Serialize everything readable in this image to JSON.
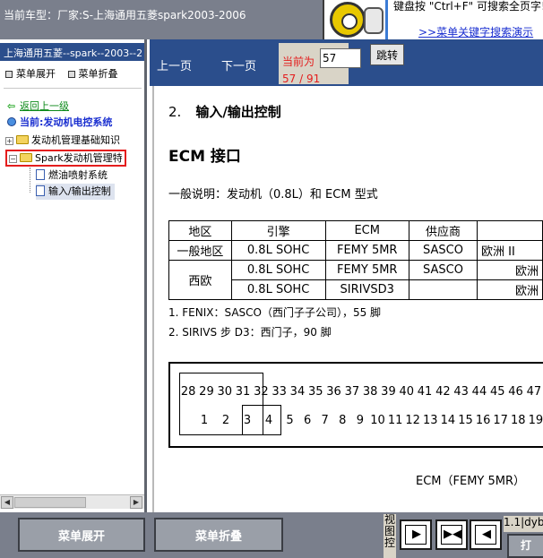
{
  "topbar": {
    "car_title": "当前车型：厂家:S-上海通用五菱spark2003-2006",
    "tip_text": "键盘按 \"Ctrl+F\" 可搜索全页字!",
    "tip_link": ">>菜单关键字搜索演示"
  },
  "left_panel": {
    "header": "上海通用五菱--spark--2003--2",
    "toolbar": {
      "expand": "菜单展开",
      "collapse": "菜单折叠"
    },
    "tree": {
      "back": "返回上一级",
      "current": "当前:发动机电控系统",
      "items": [
        {
          "label": "发动机管理基础知识",
          "type": "folder"
        },
        {
          "label": "Spark发动机管理特",
          "type": "folder",
          "highlighted": true
        },
        {
          "label": "燃油喷射系统",
          "type": "doc"
        },
        {
          "label": "输入/输出控制",
          "type": "doc",
          "selected": true
        }
      ]
    }
  },
  "nav": {
    "prev": "上一页",
    "next": "下一页",
    "current_label": "当前为",
    "page_value": "57",
    "page_count": "57 / 91",
    "jump": "跳转"
  },
  "document": {
    "section_number": "2.",
    "section_title": "输入/输出控制",
    "ecm_heading": "ECM 接口",
    "general_desc": "一般说明：发动机（0.8L）和 ECM 型式",
    "table": {
      "headers": [
        "地区",
        "引擎",
        "ECM",
        "供应商",
        ""
      ],
      "rows": [
        {
          "region": "一般地区",
          "engine": "0.8L SOHC",
          "ecm": "FEMY 5MR",
          "supplier": "SASCO",
          "market": "欧洲 II"
        },
        {
          "region": "西欧",
          "engine": "0.8L SOHC",
          "ecm": "FEMY 5MR",
          "supplier": "SASCO",
          "market": "欧洲"
        },
        {
          "region": "",
          "engine": "0.8L SOHC",
          "ecm": "SIRIVSD3",
          "supplier": "",
          "market": "欧洲"
        }
      ]
    },
    "note1": "1.    FENIX：SASCO（西门子子公司），55 脚",
    "note2": "2.    SIRIVS 步 D3：西门子，90 脚",
    "connector": {
      "top_pins": [
        "28",
        "29",
        "30",
        "31",
        "32",
        "33",
        "34",
        "35",
        "36",
        "37",
        "38",
        "39",
        "40",
        "41",
        "42",
        "43",
        "44",
        "45",
        "46",
        "47"
      ],
      "bottom_pins": [
        "1",
        "2",
        "3",
        "4",
        "5",
        "6",
        "7",
        "8",
        "9",
        "10",
        "11",
        "12",
        "13",
        "14",
        "15",
        "16",
        "17",
        "18",
        "19"
      ]
    },
    "caption": "ECM（FEMY 5MR）"
  },
  "bottombar": {
    "expand": "菜单展开",
    "collapse": "菜单折叠",
    "view_control": "视图控",
    "status": "1.1|dyb",
    "corner": "打"
  },
  "colors": {
    "chrome_gray": "#7a7f8c",
    "nav_blue": "#2b4e8c",
    "highlight_red": "#e41d1d",
    "link_green": "#0c8a1a"
  }
}
